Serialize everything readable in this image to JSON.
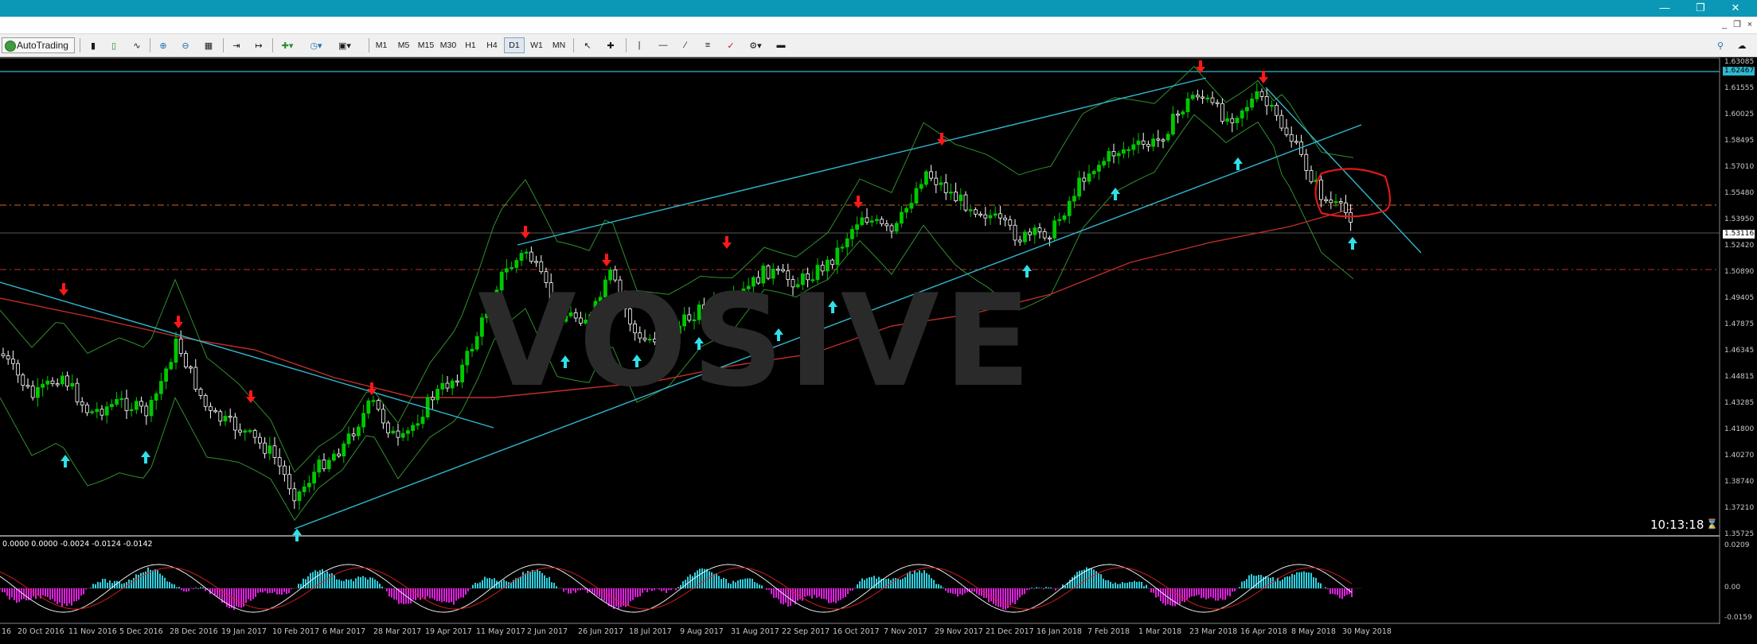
{
  "toolbar": {
    "autotrading_label": "AutoTrading",
    "timeframes": [
      "M1",
      "M5",
      "M15",
      "M30",
      "H1",
      "H4",
      "D1",
      "W1",
      "MN"
    ],
    "active_timeframe": "D1"
  },
  "chart": {
    "watermark": "VOSIVE",
    "clock": "10:13:18",
    "indicator_label": "0.0000 0.0000 -0.0024 -0.0124 -0.0142",
    "price_labels": [
      "1.63085",
      "1.61555",
      "1.60025",
      "1.58495",
      "1.57010",
      "1.55480",
      "1.53950",
      "1.52420",
      "1.50890",
      "1.49405",
      "1.47875",
      "1.46345",
      "1.44815",
      "1.43285",
      "1.41800",
      "1.40270",
      "1.38740",
      "1.37210",
      "1.35725"
    ],
    "highlight_upper": "1.62467",
    "highlight_current": "1.53116",
    "indicator_scale": [
      "0.0209",
      "0.00",
      "-0.0159"
    ],
    "date_labels": [
      "16",
      "20 Oct 2016",
      "11 Nov 2016",
      "5 Dec 2016",
      "28 Dec 2016",
      "19 Jan 2017",
      "10 Feb 2017",
      "6 Mar 2017",
      "28 Mar 2017",
      "19 Apr 2017",
      "11 May 2017",
      "2 Jun 2017",
      "26 Jun 2017",
      "18 Jul 2017",
      "9 Aug 2017",
      "31 Aug 2017",
      "22 Sep 2017",
      "16 Oct 2017",
      "7 Nov 2017",
      "29 Nov 2017",
      "21 Dec 2017",
      "16 Jan 2018",
      "7 Feb 2018",
      "1 Mar 2018",
      "23 Mar 2018",
      "16 Apr 2018",
      "8 May 2018",
      "30 May 2018"
    ],
    "colors": {
      "background": "#000000",
      "bull_candle": "#00c800",
      "bear_candle": "#ffffff",
      "bollinger": "#2f8f2f",
      "moving_average": "#c0302a",
      "trendline": "#30b8d0",
      "up_arrow": "#30e0e8",
      "down_arrow": "#ff1818",
      "histogram_pos": "#30d0e0",
      "histogram_neg": "#e020e0",
      "titlebar": "#0a98b6"
    }
  }
}
